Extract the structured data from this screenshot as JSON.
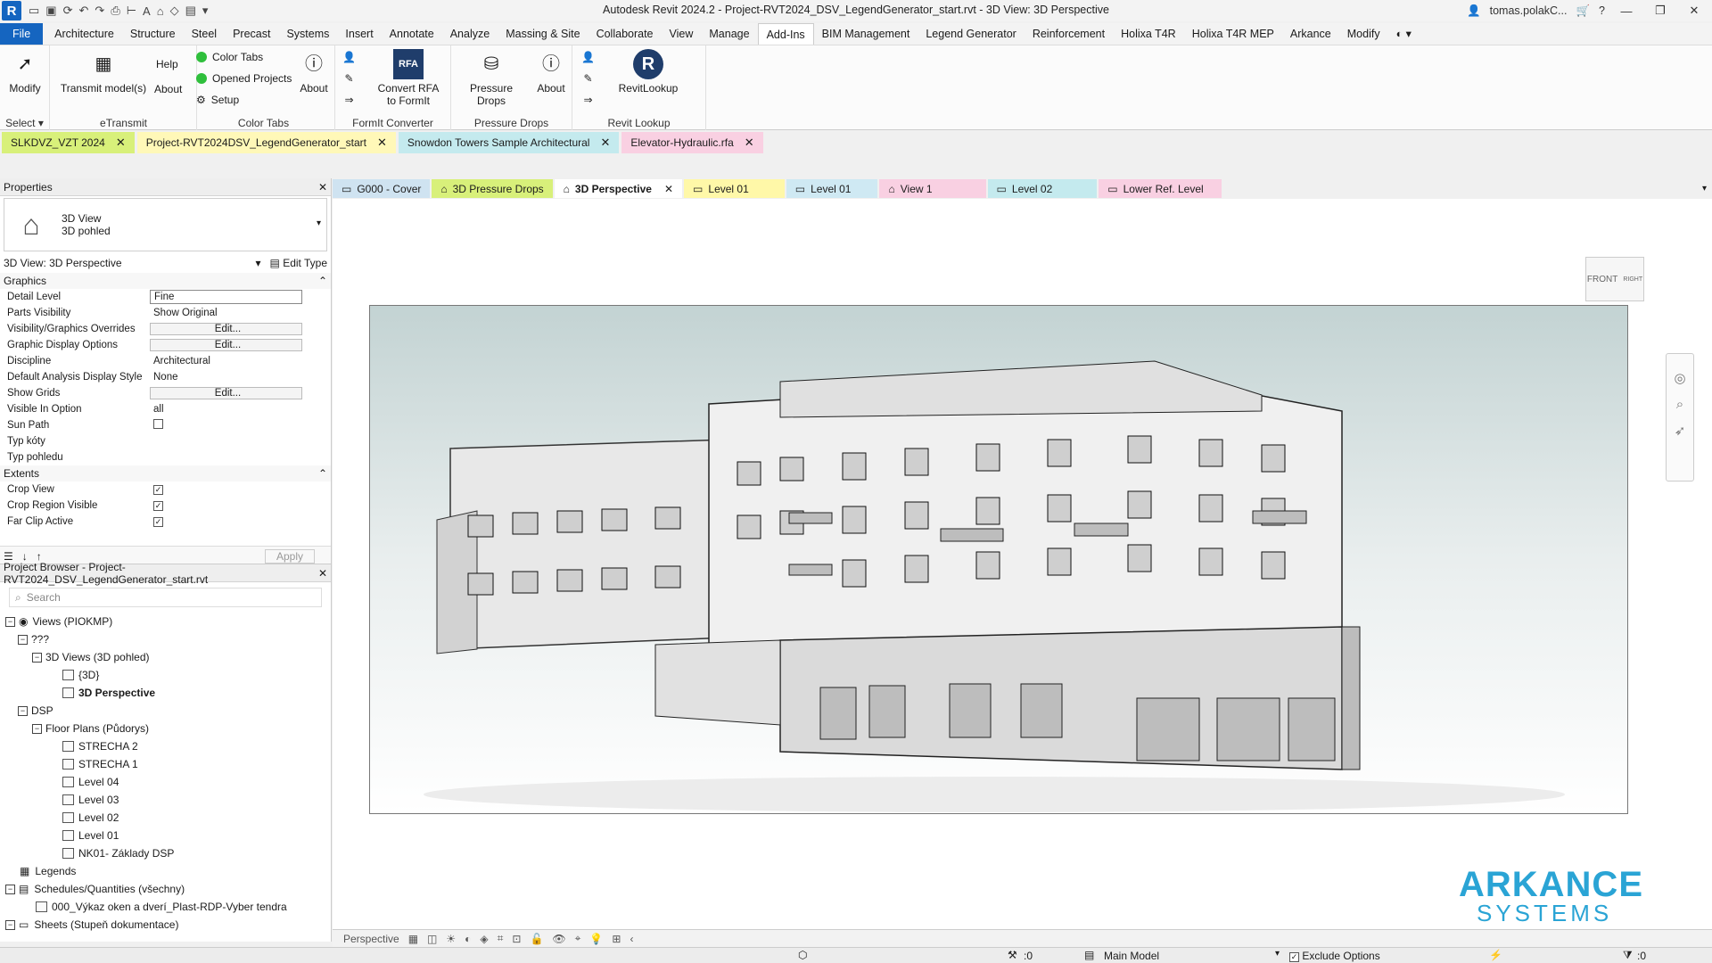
{
  "app": {
    "logo_letter": "R",
    "window_title": "Autodesk Revit 2024.2 - Project-RVT2024_DSV_LegendGenerator_start.rvt - 3D View: 3D Perspective",
    "user": "tomas.polakC...",
    "help": "?"
  },
  "menu": [
    "File",
    "Architecture",
    "Structure",
    "Steel",
    "Precast",
    "Systems",
    "Insert",
    "Annotate",
    "Analyze",
    "Massing & Site",
    "Collaborate",
    "View",
    "Manage",
    "Add-Ins",
    "BIM Management",
    "Legend Generator",
    "Reinforcement",
    "Holixa T4R",
    "Holixa T4R MEP",
    "Arkance",
    "Modify"
  ],
  "ribbon": {
    "modify": "Modify",
    "select": "Select",
    "transmit": "Transmit model(s)",
    "help": "Help",
    "about1": "About",
    "etransmit": "eTransmit",
    "color_tabs": "Color Tabs",
    "opened_projects": "Opened Projects",
    "setup": "Setup",
    "about2": "About",
    "color_tabs_group": "Color Tabs",
    "convert_rfa": "Convert RFA",
    "to_formit": "to FormIt",
    "formit_converter": "FormIt Converter",
    "pressure_drops": "Pressure Drops",
    "about3": "About",
    "pressure_drops_group": "Pressure Drops",
    "revitlookup": "RevitLookup",
    "revit_lookup_group": "Revit Lookup"
  },
  "doc_tabs": [
    {
      "label": "SLKDVZ_VZT 2024",
      "color": "#d8f07a"
    },
    {
      "label": "Project-RVT2024DSV_LegendGenerator_start",
      "color": "#fff8b8"
    },
    {
      "label": "Snowdon Towers Sample Architectural",
      "color": "#c4eaee"
    },
    {
      "label": "Elevator-Hydraulic.rfa",
      "color": "#f9d0e2"
    }
  ],
  "view_tabs": [
    {
      "label": "G000 - Cover",
      "color": "#cfe3f1"
    },
    {
      "label": "3D Pressure Drops",
      "color": "#d8f07a"
    },
    {
      "label": "3D Perspective",
      "color": "#ffffff"
    },
    {
      "label": "Level 01",
      "color": "#fff8a8"
    },
    {
      "label": "Level 01",
      "color": "#cfe9f3"
    },
    {
      "label": "View 1",
      "color": "#f9d0e2"
    },
    {
      "label": "Level 02",
      "color": "#c4eaee"
    },
    {
      "label": "Lower Ref. Level",
      "color": "#f9d0e2"
    }
  ],
  "properties": {
    "title": "Properties",
    "type_line1": "3D View",
    "type_line2": "3D pohled",
    "instance": "3D View: 3D Perspective",
    "edit_type": "Edit Type",
    "graphics": "Graphics",
    "extents": "Extents",
    "apply": "Apply",
    "rows": [
      {
        "name": "Detail Level",
        "value": "Fine"
      },
      {
        "name": "Parts Visibility",
        "value": "Show Original"
      },
      {
        "name": "Visibility/Graphics Overrides",
        "value": "Edit..."
      },
      {
        "name": "Graphic Display Options",
        "value": "Edit..."
      },
      {
        "name": "Discipline",
        "value": "Architectural"
      },
      {
        "name": "Default Analysis Display Style",
        "value": "None"
      },
      {
        "name": "Show Grids",
        "value": "Edit..."
      },
      {
        "name": "Visible In Option",
        "value": "all"
      },
      {
        "name": "Sun Path",
        "value": ""
      },
      {
        "name": "Typ kóty",
        "value": ""
      },
      {
        "name": "Typ pohledu",
        "value": ""
      }
    ],
    "extent_rows": [
      {
        "name": "Crop View",
        "value": "✓"
      },
      {
        "name": "Crop Region Visible",
        "value": "✓"
      },
      {
        "name": "Far Clip Active",
        "value": "✓"
      }
    ]
  },
  "browser": {
    "title": "Project Browser - Project-RVT2024_DSV_LegendGenerator_start.rvt",
    "search_placeholder": "Search",
    "views": "Views (PIOKMP)",
    "unk": "???",
    "views3d": "3D Views (3D pohled)",
    "v3d": "{3D}",
    "persp": "3D Perspective",
    "dsp": "DSP",
    "floorplans": "Floor Plans (Půdorys)",
    "plans": [
      "STRECHA 2",
      "STRECHA 1",
      "Level 04",
      "Level 03",
      "Level 02",
      "Level 01",
      "NK01- Základy DSP"
    ],
    "legends": "Legends",
    "schedules": "Schedules/Quantities (všechny)",
    "schedule1": "000_Výkaz oken a dverí_Plast-RDP-Vyber tendra",
    "sheets": "Sheets (Stupeň dokumentace)"
  },
  "viewcube": {
    "front": "FRONT",
    "right": "RIGHT"
  },
  "logo": {
    "top": "ARKANCE",
    "bottom": "SYSTEMS"
  },
  "view_control": {
    "mode": "Perspective"
  },
  "status": {
    "worksets_count": ":0",
    "model": "Main Model",
    "exclude": "Exclude Options",
    "filter_count": ":0"
  }
}
